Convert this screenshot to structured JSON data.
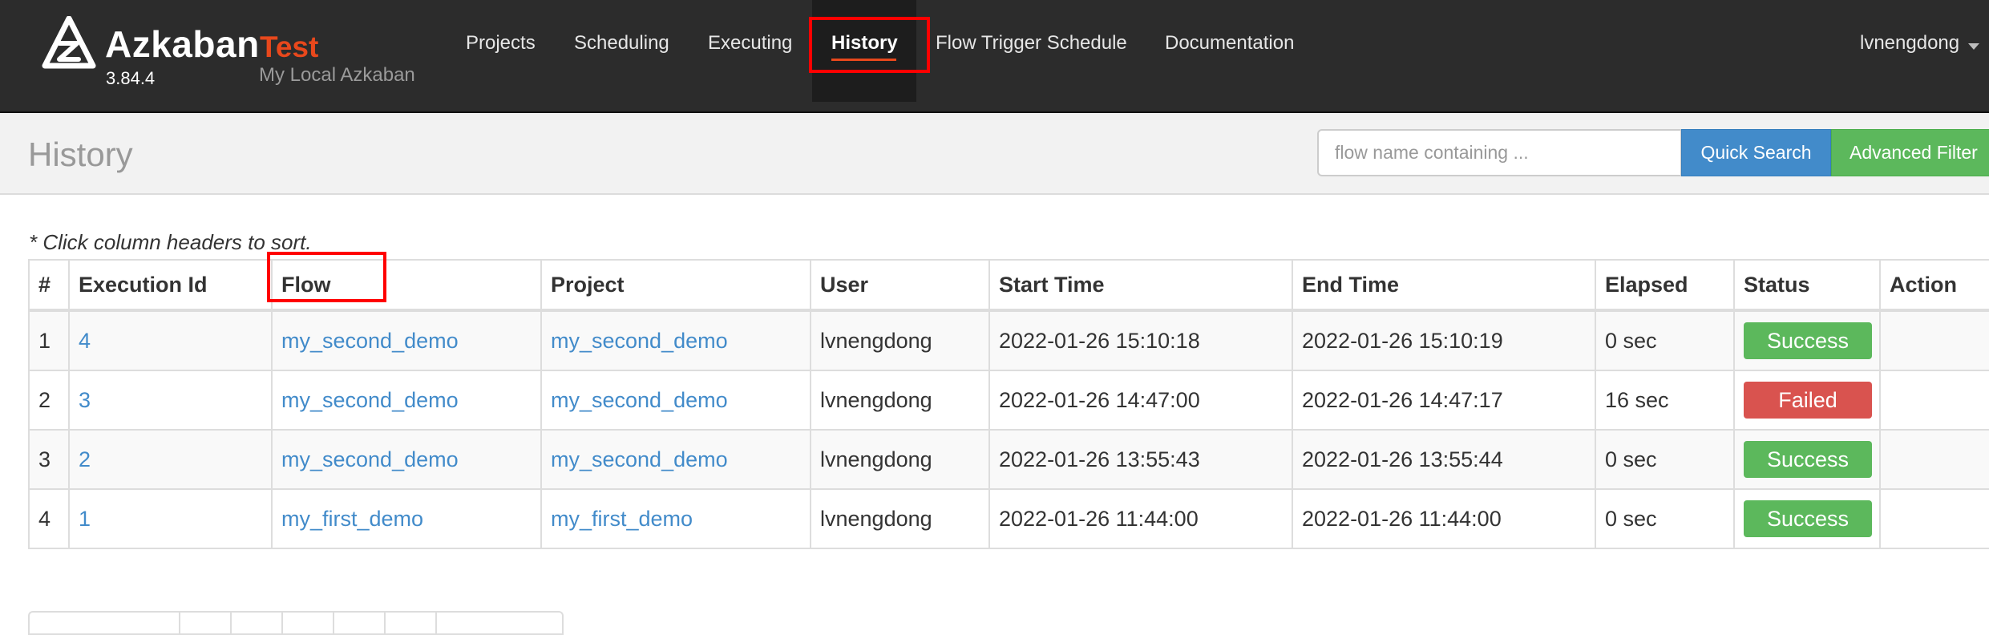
{
  "brand": {
    "name": "Azkaban",
    "env": "Test",
    "version": "3.84.4",
    "description": "My Local Azkaban"
  },
  "nav": {
    "items": [
      {
        "label": "Projects"
      },
      {
        "label": "Scheduling"
      },
      {
        "label": "Executing"
      },
      {
        "label": "History"
      },
      {
        "label": "Flow Trigger Schedule"
      },
      {
        "label": "Documentation"
      }
    ],
    "active": "History",
    "user": "lvnengdong"
  },
  "header": {
    "title": "History",
    "search_placeholder": "flow name containing ...",
    "quick_search_label": "Quick Search",
    "advanced_filter_label": "Advanced Filter"
  },
  "note": "* Click column headers to sort.",
  "table": {
    "columns": [
      "#",
      "Execution Id",
      "Flow",
      "Project",
      "User",
      "Start Time",
      "End Time",
      "Elapsed",
      "Status",
      "Action"
    ],
    "rows": [
      {
        "num": "1",
        "exec_id": "4",
        "flow": "my_second_demo",
        "project": "my_second_demo",
        "user": "lvnengdong",
        "start": "2022-01-26 15:10:18",
        "end": "2022-01-26 15:10:19",
        "elapsed": "0 sec",
        "status": "Success",
        "action": ""
      },
      {
        "num": "2",
        "exec_id": "3",
        "flow": "my_second_demo",
        "project": "my_second_demo",
        "user": "lvnengdong",
        "start": "2022-01-26 14:47:00",
        "end": "2022-01-26 14:47:17",
        "elapsed": "16 sec",
        "status": "Failed",
        "action": ""
      },
      {
        "num": "3",
        "exec_id": "2",
        "flow": "my_second_demo",
        "project": "my_second_demo",
        "user": "lvnengdong",
        "start": "2022-01-26 13:55:43",
        "end": "2022-01-26 13:55:44",
        "elapsed": "0 sec",
        "status": "Success",
        "action": ""
      },
      {
        "num": "4",
        "exec_id": "1",
        "flow": "my_first_demo",
        "project": "my_first_demo",
        "user": "lvnengdong",
        "start": "2022-01-26 11:44:00",
        "end": "2022-01-26 11:44:00",
        "elapsed": "0 sec",
        "status": "Success",
        "action": ""
      }
    ]
  },
  "colors": {
    "navbar": "#2c2c2c",
    "accent": "#e8481c",
    "link": "#428bca",
    "success": "#5cb85c",
    "failed": "#d9534f",
    "highlight": "#ff0000"
  },
  "icons": {
    "logo": "azkaban-logo-icon",
    "user_caret": "caret-down-icon"
  }
}
